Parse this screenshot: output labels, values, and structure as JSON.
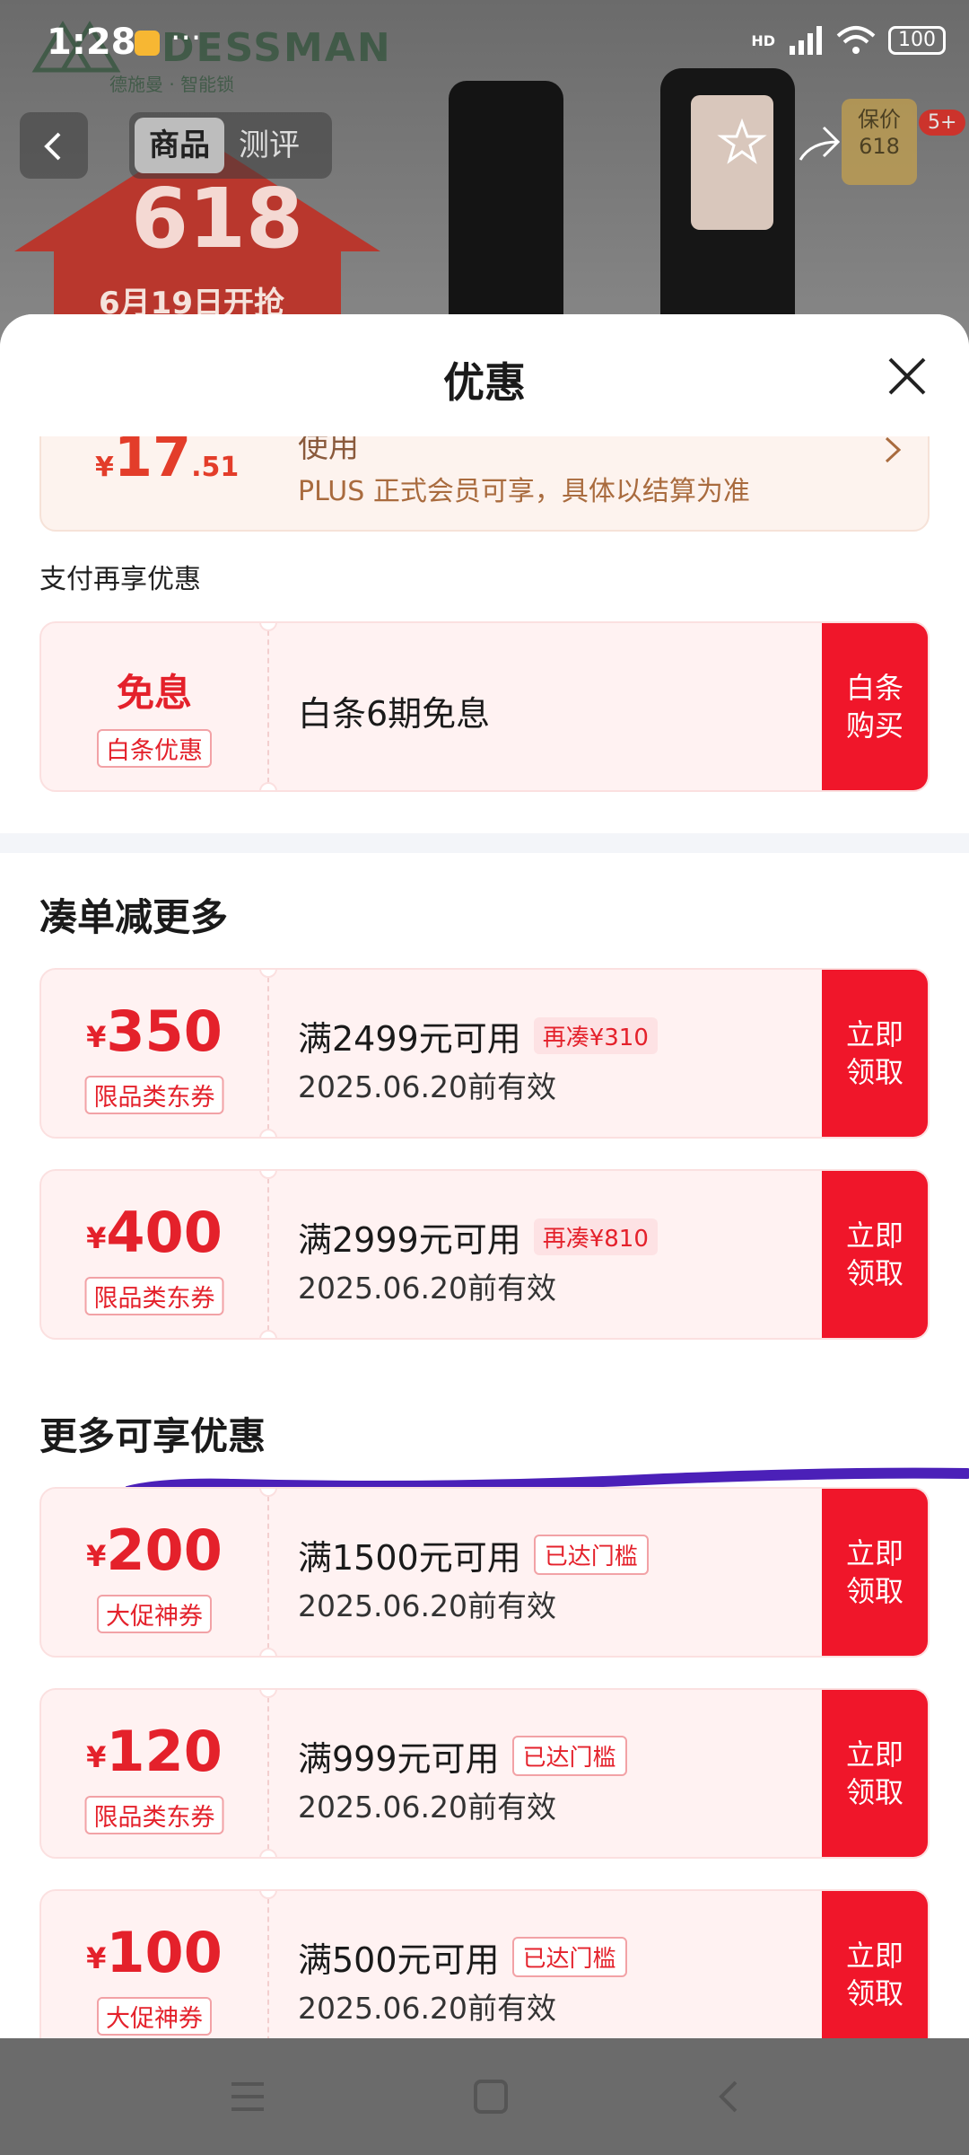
{
  "status": {
    "time": "1:28",
    "more": "···",
    "network": "HD",
    "battery": "100"
  },
  "background": {
    "brand_name": "DESSMAN",
    "brand_sub": "德施曼 · 智能锁",
    "promo_big": "618",
    "promo_date": "6月19日开抢",
    "tabs": [
      {
        "label": "商品",
        "active": true
      },
      {
        "label": "测评",
        "active": false
      }
    ],
    "price_badge": "保价\n618",
    "badge_count": "5+"
  },
  "sheet": {
    "title": "优惠",
    "plus": {
      "currency": "¥",
      "amount": "17",
      "decimal": ".51",
      "line1": "使用",
      "line2": "PLUS 正式会员可享，具体以结算为准"
    },
    "pay_section": "支付再享优惠",
    "baitiao": {
      "main": "免息",
      "tag": "白条优惠",
      "desc": "白条6期免息",
      "action": "白条\n购买"
    },
    "more_section": "凑单减更多",
    "more_coupons": [
      {
        "currency": "¥",
        "amount": "350",
        "tag": "限品类东券",
        "cond": "满2499元可用",
        "pill": "再凑¥310",
        "expire": "2025.06.20前有效",
        "action": "立即\n领取"
      },
      {
        "currency": "¥",
        "amount": "400",
        "tag": "限品类东券",
        "cond": "满2999元可用",
        "pill": "再凑¥810",
        "expire": "2025.06.20前有效",
        "action": "立即\n领取"
      }
    ],
    "enjoy_section": "更多可享优惠",
    "enjoy_coupons": [
      {
        "currency": "¥",
        "amount": "200",
        "tag": "大促神券",
        "cond": "满1500元可用",
        "pill": "已达门槛",
        "expire": "2025.06.20前有效",
        "action": "立即\n领取"
      },
      {
        "currency": "¥",
        "amount": "120",
        "tag": "限品类东券",
        "cond": "满999元可用",
        "pill": "已达门槛",
        "expire": "2025.06.20前有效",
        "action": "立即\n领取"
      },
      {
        "currency": "¥",
        "amount": "100",
        "tag": "大促神券",
        "cond": "满500元可用",
        "pill": "已达门槛",
        "expire": "2025.06.20前有效",
        "action": "立即\n领取"
      }
    ]
  },
  "colors": {
    "accent": "#f0162a",
    "coupon_bg": "#fff2f2",
    "plus_text": "#a96b3e",
    "scribble": "#4b20b8"
  },
  "icons": [
    "back-icon",
    "star-icon",
    "share-icon",
    "close-icon",
    "chevron-right-icon",
    "menu-icon",
    "home-icon",
    "nav-back-icon"
  ]
}
